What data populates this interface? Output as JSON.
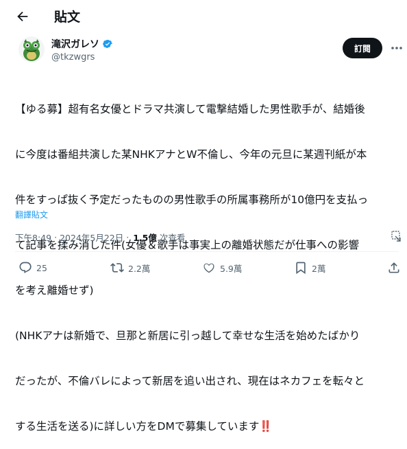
{
  "header": {
    "title": "貼文"
  },
  "author": {
    "name": "滝沢ガレソ",
    "handle": "@tkzwgrs"
  },
  "subscribe_label": "訂閱",
  "tweet": {
    "lines": [
      "【ゆる募】超有名女優とドラマ共演して電撃結婚した男性歌手が、結婚後",
      "に今度は番組共演した某NHKアナとW不倫し、今年の元旦に某週刊紙が本",
      "件をすっぱ抜く予定だったものの男性歌手の所属事務所が10億円を支払っ",
      "て記事を揉み消した件(女優＆歌手は事実上の離婚状態だが仕事への影響",
      "を考え離婚せず)",
      "(NHKアナは新婚で、旦那と新居に引っ越して幸せな生活を始めたばかり",
      "だったが、不倫バレによって新居を追い出され、現在はネカフェを転々と",
      "する生活を送る)に詳しい方をDMで募集しています‼️"
    ],
    "translate_label": "翻譯貼文"
  },
  "meta": {
    "time": "下午8:49",
    "separator": "·",
    "date": "2024年5月22日",
    "views_count": "1.5億",
    "views_label": "次查看"
  },
  "actions": {
    "reply": "25",
    "repost": "2.2萬",
    "like": "5.9萬",
    "bookmark": "2萬"
  },
  "colors": {
    "accent": "#1d9bf0",
    "text": "#0f1419",
    "muted": "#536471",
    "alert": "#f4212e"
  }
}
